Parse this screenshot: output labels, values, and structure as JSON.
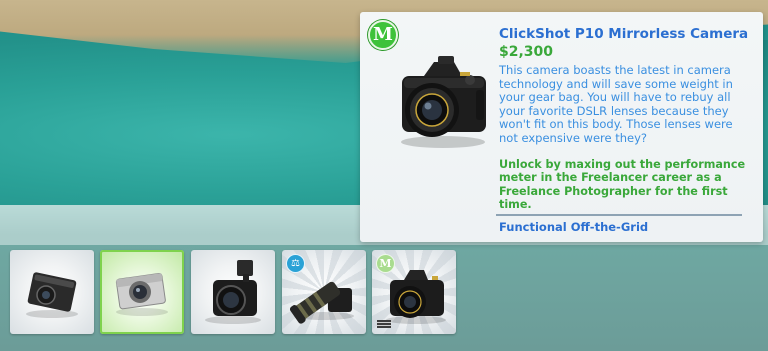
{
  "tooltip": {
    "badge_letter": "M",
    "title": "ClickShot P10 Mirrorless Camera",
    "price": "$2,300",
    "description": "This camera boasts the latest in camera technology and will save some weight in your gear bag. You will have to rebuy all your favorite DSLR lenses because they won't fit on this body. Those lenses were not expensive were they?",
    "unlock_text": "Unlock by maxing out the performance meter in the Freelancer career as a Freelance Photographer for the first time.",
    "footer": "Functional Off-the-Grid",
    "product_icon": "mirrorless-camera-icon"
  },
  "colors": {
    "title_blue": "#2b6fd1",
    "desc_blue": "#3a8fe0",
    "green": "#3aa83a",
    "badge_green": "#3ec23a"
  },
  "items": [
    {
      "icon": "compact-camera-icon",
      "selected": false
    },
    {
      "icon": "silver-camera-icon",
      "selected": true
    },
    {
      "icon": "flash-camera-icon",
      "selected": false
    },
    {
      "icon": "telephoto-lens-camera-icon",
      "selected": false,
      "badge": "scale-icon"
    },
    {
      "icon": "mirrorless-camera-icon",
      "selected": false,
      "badge_letter": "M",
      "owned_indicator": "bars-icon"
    }
  ]
}
